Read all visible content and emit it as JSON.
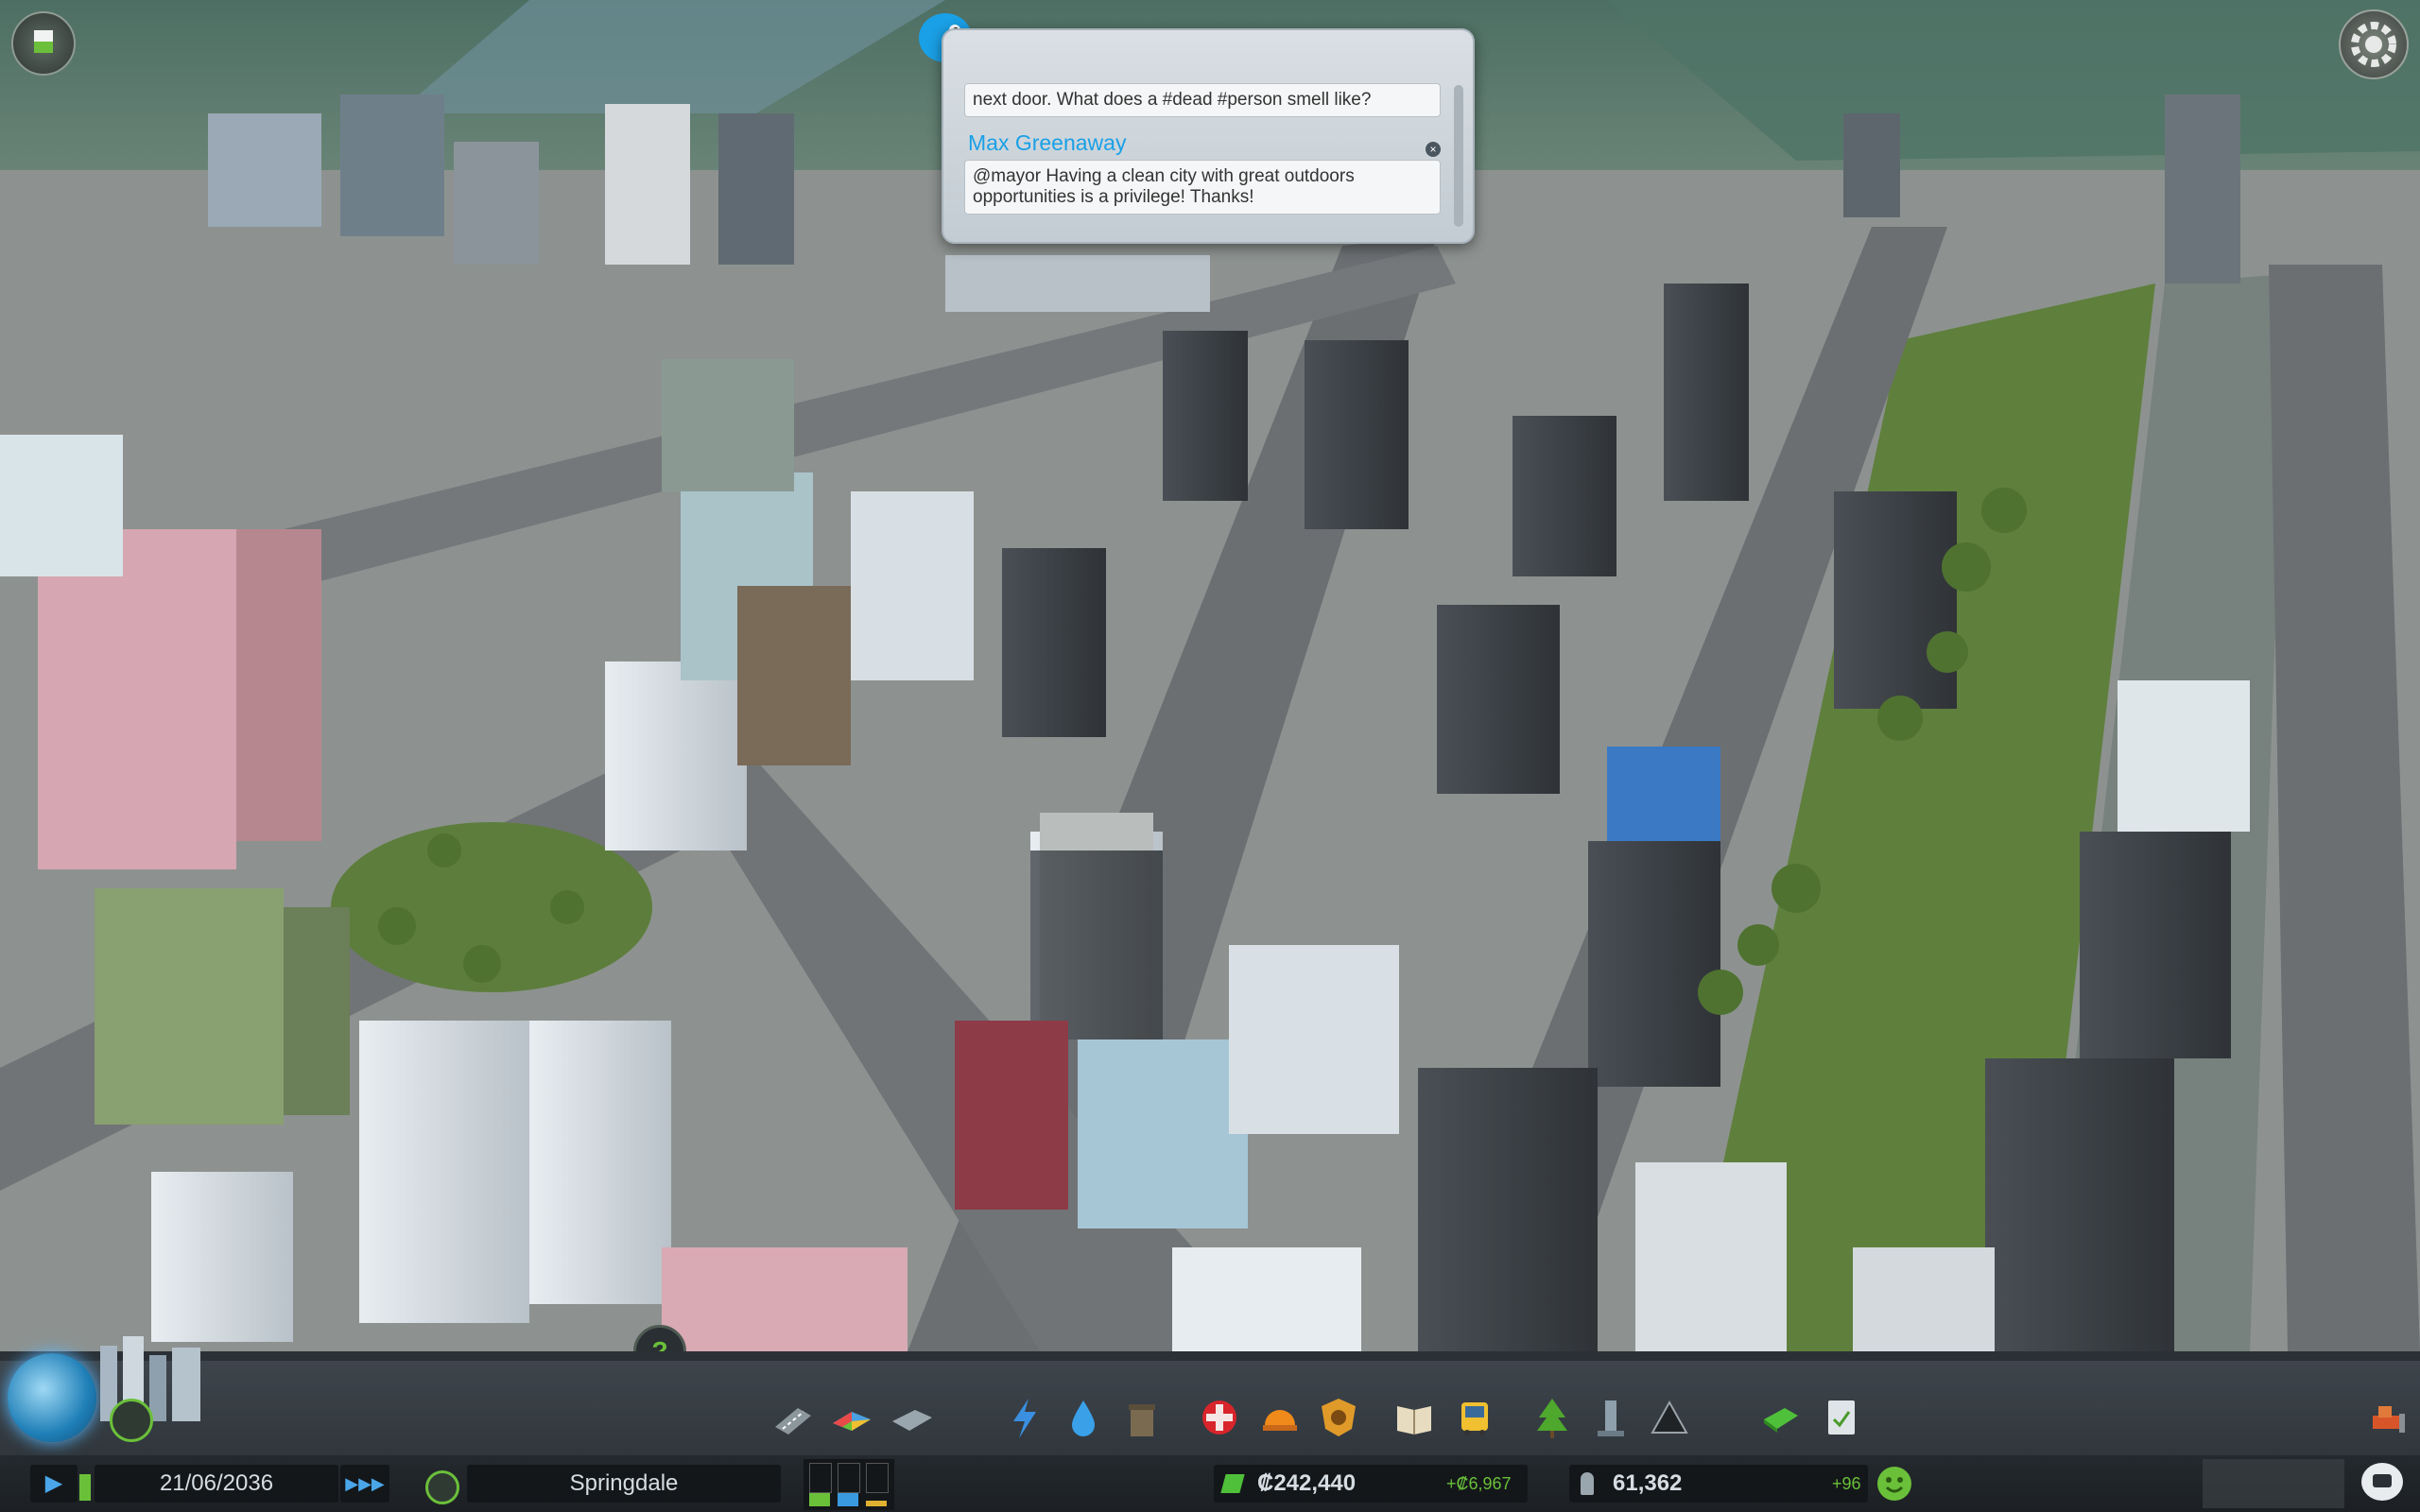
{
  "chirper": {
    "prev_message": "next door. What does a #dead #person smell like?",
    "author": "Max Greenaway",
    "message": "@mayor Having a clean city with great outdoors opportunities is a privilege! Thanks!",
    "close_glyph": "×"
  },
  "time": {
    "date": "21/06/2036",
    "play_glyph": "▶",
    "speed_glyph": "▶▶▶"
  },
  "city": {
    "name": "Springdale"
  },
  "money": {
    "balance": "₡242,440",
    "income": "+₡6,967"
  },
  "population": {
    "count": "61,362",
    "change": "+96"
  },
  "help_glyph": "?",
  "toolbar": {
    "tools": [
      {
        "name": "roads-icon"
      },
      {
        "name": "zoning-icon"
      },
      {
        "name": "districts-icon"
      },
      {
        "name": "electricity-icon"
      },
      {
        "name": "water-icon"
      },
      {
        "name": "garbage-icon"
      },
      {
        "name": "healthcare-icon"
      },
      {
        "name": "fire-department-icon"
      },
      {
        "name": "police-icon"
      },
      {
        "name": "education-icon"
      },
      {
        "name": "public-transport-icon"
      },
      {
        "name": "parks-icon"
      },
      {
        "name": "unique-buildings-icon"
      },
      {
        "name": "monuments-icon"
      },
      {
        "name": "economy-icon"
      },
      {
        "name": "policies-icon"
      }
    ]
  },
  "colors": {
    "accent_green": "#69c038",
    "chirper_blue": "#1aa0e6",
    "toolbar_bg": "#363c42"
  }
}
